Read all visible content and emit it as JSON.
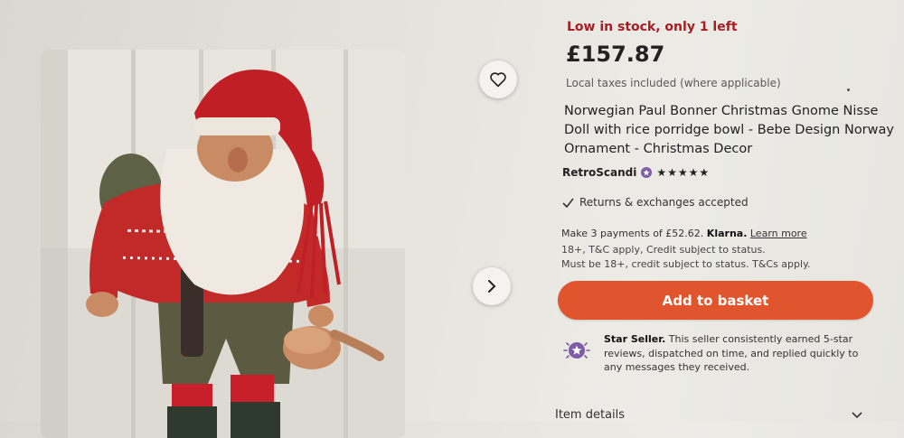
{
  "listing": {
    "stock_notice": "Low in stock, only 1 left",
    "price": "£157.87",
    "taxes_note": "Local taxes included (where applicable)",
    "title": "Norwegian Paul Bonner Christmas Gnome Nisse Doll with rice porridge bowl - Bebe Design Norway Ornament - Christmas Decor",
    "shop_name": "RetroScandi",
    "rating_stars": "★★★★★",
    "returns": "Returns & exchanges accepted",
    "klarna": {
      "text_before": "Make 3 payments of £52.62.",
      "brand": "Klarna.",
      "learn_more": "Learn more",
      "line2": "18+, T&C apply, Credit subject to status.",
      "line3": "Must be 18+, credit subject to status. T&Cs apply."
    },
    "add_to_basket": "Add to basket",
    "star_seller": {
      "label": "Star Seller.",
      "text": "This seller consistently earned 5-star reviews, dispatched on time, and replied quickly to any messages they received."
    },
    "item_details": "Item details"
  },
  "icons": {
    "favorite": "heart-icon",
    "next": "chevron-right-icon",
    "verified": "star-seller-badge-icon",
    "check": "checkmark-icon",
    "expand": "chevron-down-icon"
  },
  "colors": {
    "accent": "#e0552d",
    "stock": "#a61d24",
    "star_seller": "#7d5ba6"
  }
}
